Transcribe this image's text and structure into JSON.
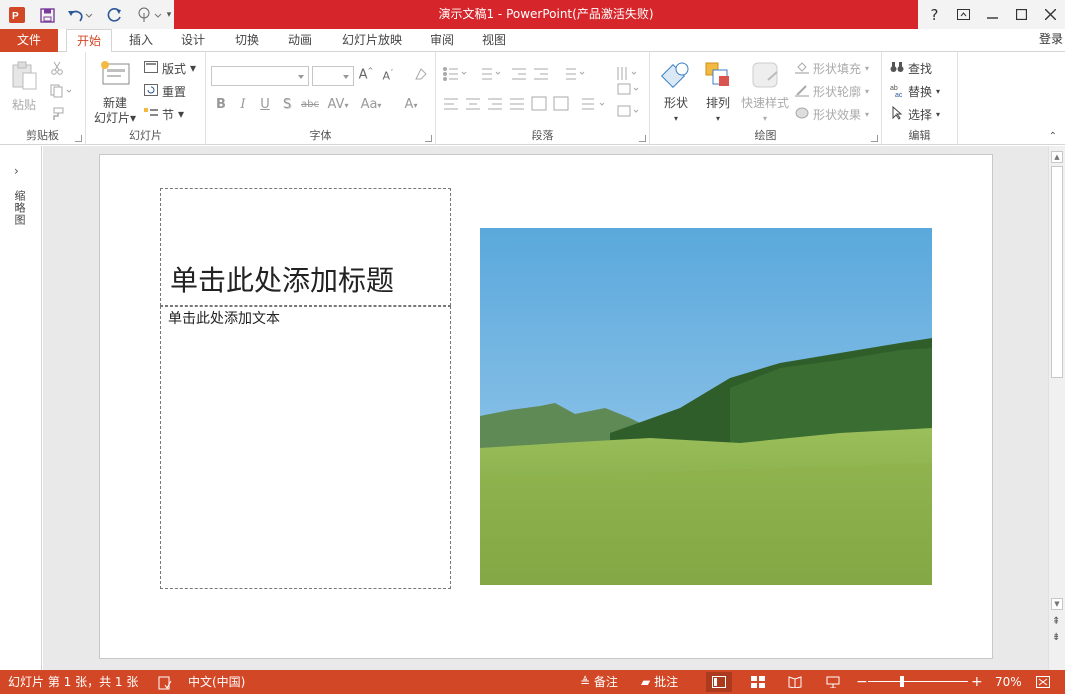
{
  "window": {
    "title": "演示文稿1 - PowerPoint(产品激活失败)",
    "controls": [
      "?",
      "ribbon-display",
      "minimize",
      "maximize",
      "close"
    ]
  },
  "quick_access": [
    "save-icon",
    "undo-icon",
    "redo-icon",
    "touch-mode-icon"
  ],
  "tabs": [
    "文件",
    "开始",
    "插入",
    "设计",
    "切换",
    "动画",
    "幻灯片放映",
    "审阅",
    "视图"
  ],
  "active_tab": "开始",
  "account": {
    "login_label": "登录"
  },
  "ribbon": {
    "clipboard": {
      "paste": "粘贴",
      "label": "剪贴板"
    },
    "slides": {
      "new_slide_1": "新建",
      "new_slide_2": "幻灯片",
      "layout": "版式",
      "reset": "重置",
      "section": "节",
      "label": "幻灯片"
    },
    "font": {
      "label": "字体",
      "buttons": [
        "B",
        "I",
        "U",
        "S",
        "abc",
        "AV",
        "Aa",
        "A"
      ]
    },
    "paragraph": {
      "label": "段落"
    },
    "drawing": {
      "shapes": "形状",
      "arrange": "排列",
      "quick_styles": "快速样式",
      "shape_fill": "形状填充",
      "shape_outline": "形状轮廓",
      "shape_effects": "形状效果",
      "label": "绘图"
    },
    "editing": {
      "find": "查找",
      "replace": "替换",
      "select": "选择",
      "label": "编辑"
    }
  },
  "left_panel": {
    "label": "缩略图"
  },
  "slide": {
    "title_placeholder": "单击此处添加标题",
    "body_placeholder": "单击此处添加文本",
    "picture": "grassland-mountain-photo"
  },
  "status": {
    "slide_info": "幻灯片 第 1 张，共 1 张",
    "language": "中文(中国)",
    "notes": "备注",
    "comments": "批注",
    "zoom": "70%",
    "zoom_value": 70
  },
  "colors": {
    "accent": "#d24726",
    "titlebar": "#d6262b"
  }
}
